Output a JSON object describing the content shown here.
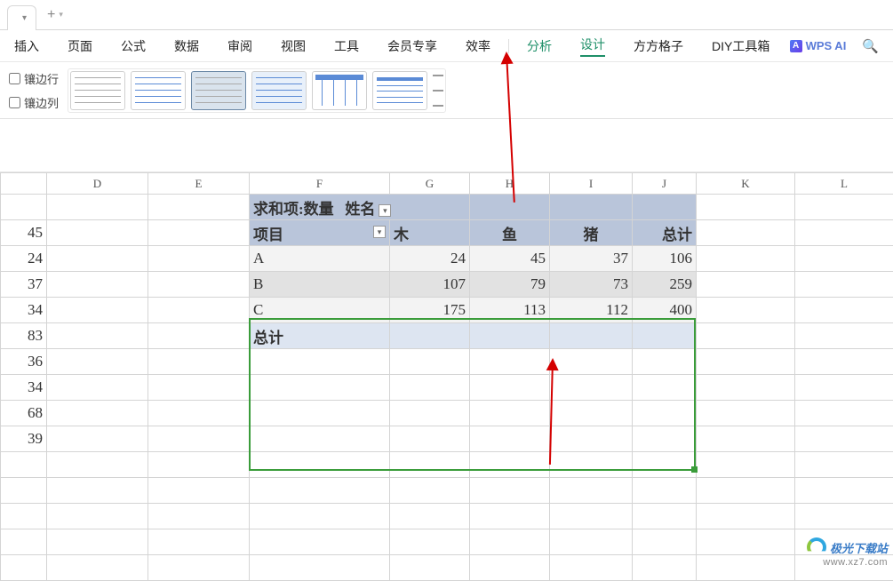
{
  "tab": {
    "doc_label": "",
    "add": "+"
  },
  "menu": {
    "items": [
      "插入",
      "页面",
      "公式",
      "数据",
      "审阅",
      "视图",
      "工具",
      "会员专享",
      "效率"
    ],
    "analysis": "分析",
    "design": "设计",
    "extra": [
      "方方格子",
      "DIY工具箱"
    ],
    "wpsai": "WPS AI"
  },
  "ribbon": {
    "banded_rows": "镶边行",
    "banded_cols": "镶边列"
  },
  "columns": [
    "D",
    "E",
    "F",
    "G",
    "H",
    "I",
    "J",
    "K",
    "L"
  ],
  "leftcol": {
    "values": [
      45,
      24,
      37,
      34,
      83,
      36,
      34,
      68,
      39
    ]
  },
  "pivot": {
    "sum_field_label": "求和项:数量",
    "name_label": "姓名",
    "proj_label": "项目",
    "col_headers": [
      "木",
      "鱼",
      "猪",
      "总计"
    ],
    "rows": [
      {
        "label": "A",
        "values": [
          24,
          45,
          37,
          106
        ]
      },
      {
        "label": "B",
        "values": [
          107,
          79,
          73,
          259
        ]
      },
      {
        "label": "C",
        "values": [
          175,
          113,
          112,
          400
        ]
      }
    ],
    "total_label": "总计"
  },
  "watermark": {
    "brand": "极光下载站",
    "url": "www.xz7.com"
  },
  "chart_data": {
    "type": "table",
    "title": "求和项:数量",
    "row_field": "项目",
    "col_field": "姓名",
    "columns": [
      "木",
      "鱼",
      "猪",
      "总计"
    ],
    "rows": [
      {
        "label": "A",
        "values": [
          24,
          45,
          37,
          106
        ]
      },
      {
        "label": "B",
        "values": [
          107,
          79,
          73,
          259
        ]
      },
      {
        "label": "C",
        "values": [
          175,
          113,
          112,
          400
        ]
      }
    ]
  }
}
